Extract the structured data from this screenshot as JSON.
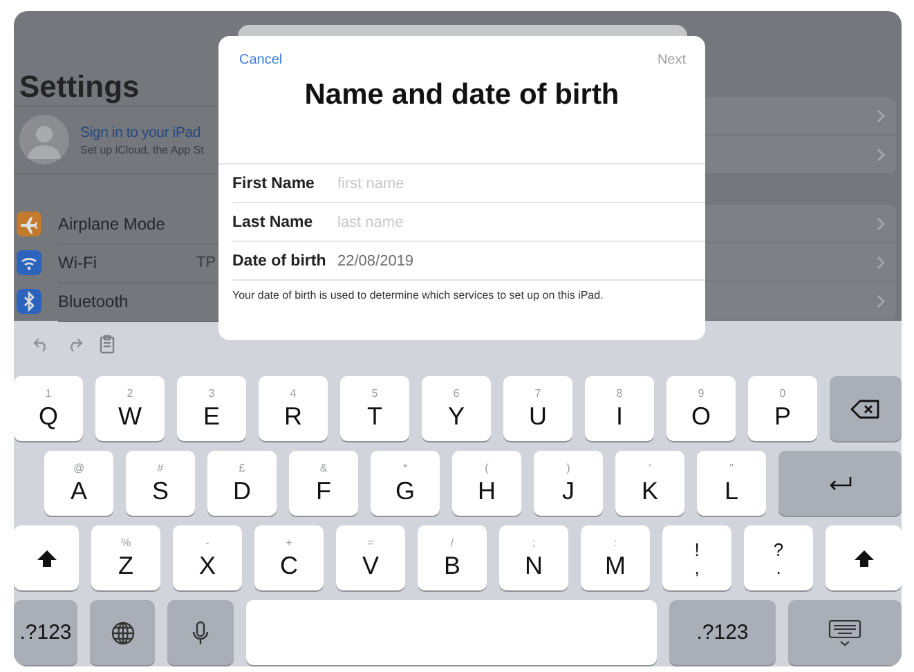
{
  "settings": {
    "title": "Settings",
    "account": {
      "title": "Sign in to your iPad",
      "subtitle": "Set up iCloud, the App St"
    },
    "items": [
      {
        "label": "Airplane Mode",
        "color": "#c27a2c"
      },
      {
        "label": "Wi-Fi",
        "value": "TP",
        "color": "#2c64bd"
      },
      {
        "label": "Bluetooth",
        "color": "#2c64bd"
      }
    ]
  },
  "modal": {
    "cancel": "Cancel",
    "next": {
      "label": "Next",
      "disabled": true
    },
    "title": "Name and date of birth",
    "fields": [
      {
        "label": "First Name",
        "placeholder": "first name"
      },
      {
        "label": "Last Name",
        "placeholder": "last name"
      },
      {
        "label": "Date of birth",
        "value": "22/08/2019"
      }
    ],
    "footnote": "Your date of birth is used to determine which services to set up on this iPad."
  },
  "keyboard": {
    "rows": [
      {
        "keys": [
          {
            "kind": "letter",
            "label": "Q",
            "alt": "1"
          },
          {
            "kind": "letter",
            "label": "W",
            "alt": "2"
          },
          {
            "kind": "letter",
            "label": "E",
            "alt": "3"
          },
          {
            "kind": "letter",
            "label": "R",
            "alt": "4"
          },
          {
            "kind": "letter",
            "label": "T",
            "alt": "5"
          },
          {
            "kind": "letter",
            "label": "Y",
            "alt": "6"
          },
          {
            "kind": "letter",
            "label": "U",
            "alt": "7"
          },
          {
            "kind": "letter",
            "label": "I",
            "alt": "8"
          },
          {
            "kind": "letter",
            "label": "O",
            "alt": "9"
          },
          {
            "kind": "letter",
            "label": "P",
            "alt": "0"
          },
          {
            "kind": "delete"
          }
        ]
      },
      {
        "keys": [
          {
            "kind": "letter",
            "label": "A",
            "alt": "@"
          },
          {
            "kind": "letter",
            "label": "S",
            "alt": "#"
          },
          {
            "kind": "letter",
            "label": "D",
            "alt": "£"
          },
          {
            "kind": "letter",
            "label": "F",
            "alt": "&"
          },
          {
            "kind": "letter",
            "label": "G",
            "alt": "*"
          },
          {
            "kind": "letter",
            "label": "H",
            "alt": "("
          },
          {
            "kind": "letter",
            "label": "J",
            "alt": ")"
          },
          {
            "kind": "letter",
            "label": "K",
            "alt": "'"
          },
          {
            "kind": "letter",
            "label": "L",
            "alt": "\""
          },
          {
            "kind": "return"
          }
        ]
      },
      {
        "keys": [
          {
            "kind": "shift"
          },
          {
            "kind": "letter",
            "label": "Z",
            "alt": "%"
          },
          {
            "kind": "letter",
            "label": "X",
            "alt": "-"
          },
          {
            "kind": "letter",
            "label": "C",
            "alt": "+"
          },
          {
            "kind": "letter",
            "label": "V",
            "alt": "="
          },
          {
            "kind": "letter",
            "label": "B",
            "alt": "/"
          },
          {
            "kind": "letter",
            "label": "N",
            "alt": ";"
          },
          {
            "kind": "letter",
            "label": "M",
            "alt": ":"
          },
          {
            "kind": "punct",
            "top": "!",
            "bottom": ","
          },
          {
            "kind": "punct",
            "top": "?",
            "bottom": "."
          },
          {
            "kind": "shift"
          }
        ]
      },
      {
        "keys": [
          {
            "kind": "mode",
            "label": ".?123"
          },
          {
            "kind": "globe"
          },
          {
            "kind": "mic"
          },
          {
            "kind": "space"
          },
          {
            "kind": "mode",
            "label": ".?123"
          },
          {
            "kind": "hide"
          }
        ]
      }
    ]
  }
}
